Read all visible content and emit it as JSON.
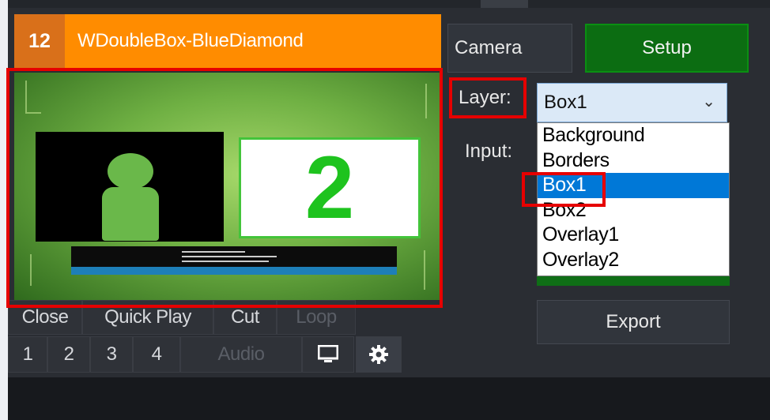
{
  "input": {
    "number": "12",
    "name": "WDoubleBox-BlueDiamond",
    "preview_number": "2",
    "buttons": {
      "close": "Close",
      "quick_play": "Quick Play",
      "cut": "Cut",
      "loop": "Loop",
      "overlay_1": "1",
      "overlay_2": "2",
      "overlay_3": "3",
      "overlay_4": "4",
      "audio": "Audio"
    },
    "icons": {
      "monitor": "monitor-icon",
      "gear": "gear-icon"
    }
  },
  "panel": {
    "camera_label": "Camera",
    "setup_label": "Setup",
    "layer_label": "Layer:",
    "input_label": "Input:",
    "layer_selected": "Box1",
    "layer_options": [
      "Background",
      "Borders",
      "Box1",
      "Box2",
      "Overlay1",
      "Overlay2"
    ],
    "export_label": "Export"
  },
  "colors": {
    "title_bar": "#ff8c00",
    "setup_green": "#0c6d12",
    "selection_blue": "#0078d7",
    "highlight_red": "#e60000"
  }
}
